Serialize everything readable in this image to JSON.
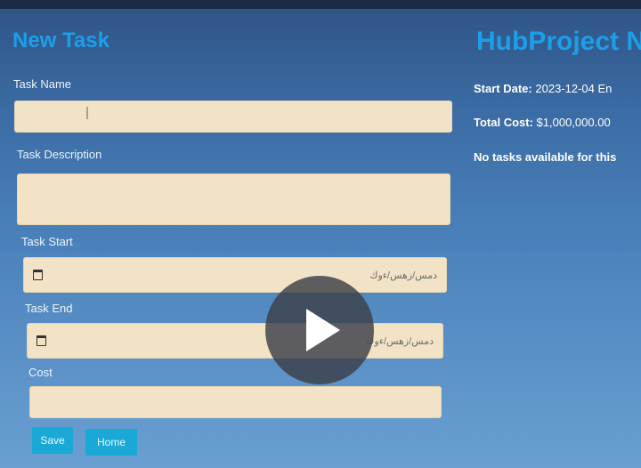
{
  "form": {
    "title": "New Task",
    "task_name_label": "Task Name",
    "task_description_label": "Task Description",
    "task_start_label": "Task Start",
    "task_end_label": "Task End",
    "cost_label": "Cost",
    "date_placeholder": "دمس/زهس/ءوك",
    "save_label": "Save",
    "home_label": "Home"
  },
  "project": {
    "title": "HubProject N",
    "start_date_label": "Start Date:",
    "start_date_value": "2023-12-04",
    "end_date_label_partial": "En",
    "total_cost_label": "Total Cost:",
    "total_cost_value": "$1,000,000.00",
    "no_tasks_text": "No tasks available for this"
  },
  "colors": {
    "accent": "#1d9ee8",
    "button": "#1aa9d6",
    "input_bg": "#f2e3c6"
  },
  "icons": {
    "calendar": "calendar-icon",
    "play": "play-icon"
  }
}
